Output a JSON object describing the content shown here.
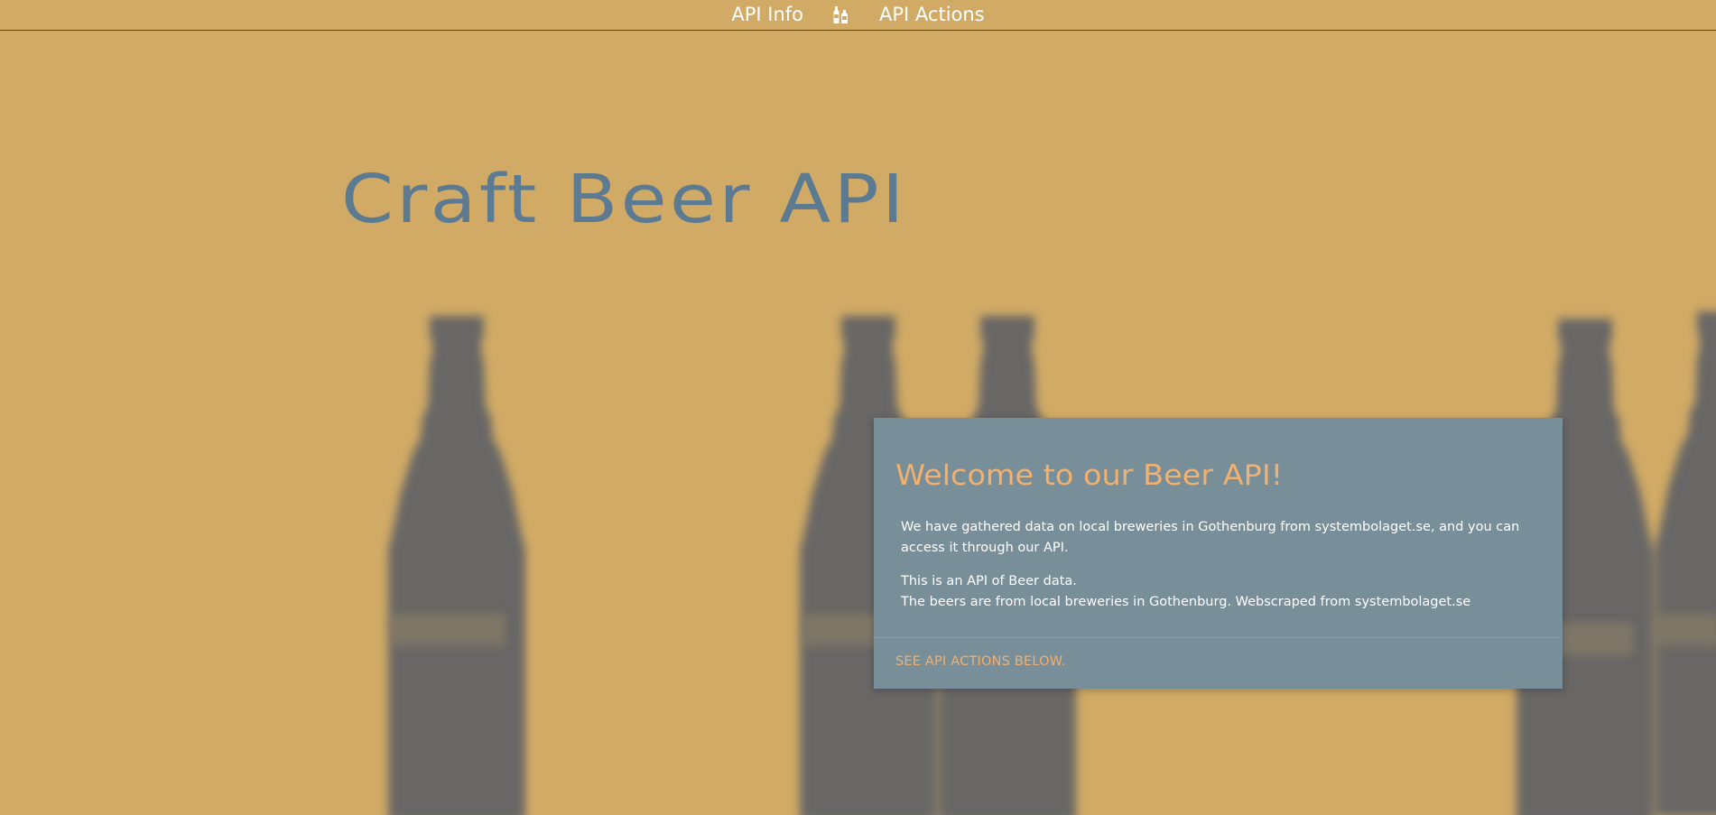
{
  "nav": {
    "items": [
      {
        "label": "API Info"
      },
      {
        "label": "API Actions"
      }
    ],
    "icon": "beer-bottles-icon"
  },
  "hero": {
    "title": "Craft Beer API"
  },
  "card": {
    "title": "Welcome to our Beer API!",
    "paragraph1": "We have gathered data on local breweries in Gothenburg from systembolaget.se, and you can access it through our API.",
    "paragraph2_line1": "This is an API of Beer data.",
    "paragraph2_line2": "The beers are from local breweries in Gothenburg. Webscraped from systembolaget.se",
    "action_label": "SEE API ACTIONS BELOW."
  },
  "colors": {
    "background": "#d1ab66",
    "hero_title": "#5c7b92",
    "card_background": "#788e98",
    "accent": "#f2b16f",
    "bottle": "#666666"
  }
}
